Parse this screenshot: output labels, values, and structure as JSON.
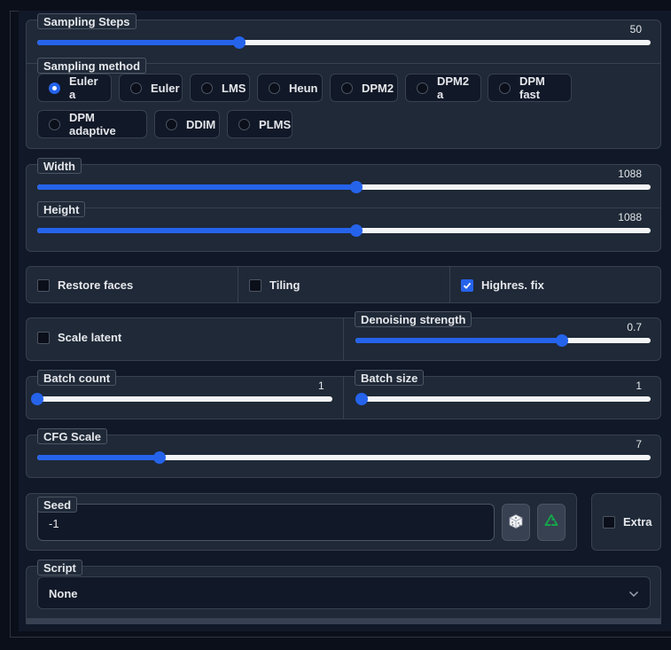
{
  "sampling_steps": {
    "label": "Sampling Steps",
    "value": "50",
    "fraction": 0.33
  },
  "sampling_method": {
    "label": "Sampling method",
    "options": [
      "Euler a",
      "Euler",
      "LMS",
      "Heun",
      "DPM2",
      "DPM2 a",
      "DPM fast",
      "DPM adaptive",
      "DDIM",
      "PLMS"
    ],
    "selected": "Euler a"
  },
  "width": {
    "label": "Width",
    "value": "1088",
    "fraction": 0.52
  },
  "height": {
    "label": "Height",
    "value": "1088",
    "fraction": 0.52
  },
  "options_row": {
    "restore_faces": {
      "label": "Restore faces",
      "checked": false
    },
    "tiling": {
      "label": "Tiling",
      "checked": false
    },
    "highres_fix": {
      "label": "Highres. fix",
      "checked": true
    }
  },
  "scale_latent": {
    "label": "Scale latent",
    "checked": false
  },
  "denoising_strength": {
    "label": "Denoising strength",
    "value": "0.7",
    "fraction": 0.7
  },
  "batch_count": {
    "label": "Batch count",
    "value": "1",
    "fraction": 0.0
  },
  "batch_size": {
    "label": "Batch size",
    "value": "1",
    "fraction": 0.0
  },
  "cfg_scale": {
    "label": "CFG Scale",
    "value": "7",
    "fraction": 0.2
  },
  "seed": {
    "label": "Seed",
    "value": "-1",
    "random_icon": "dice-icon",
    "reuse_icon": "recycle-icon"
  },
  "extra": {
    "label": "Extra",
    "checked": false
  },
  "script": {
    "label": "Script",
    "selected": "None"
  },
  "colors": {
    "accent": "#2563eb",
    "panel": "#1f2937",
    "background": "#0b0f19"
  }
}
